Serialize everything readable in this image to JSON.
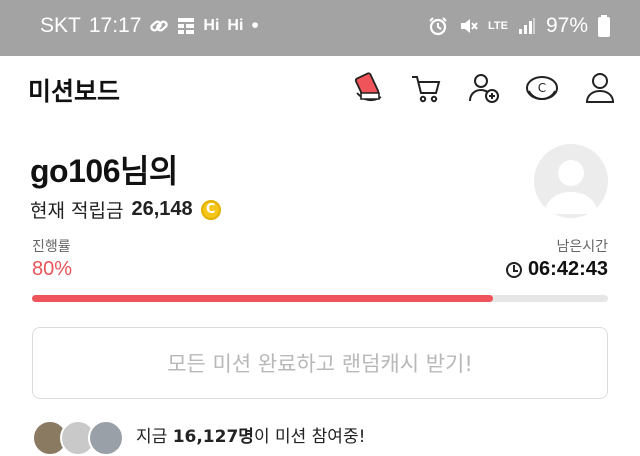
{
  "status_bar": {
    "carrier": "SKT",
    "time": "17:17",
    "hi1": "Hi",
    "hi2": "Hi",
    "dot": "•",
    "lte": "LTE",
    "battery": "97%"
  },
  "app_bar": {
    "title": "미션보드",
    "icons": [
      "mission-card-icon",
      "cart-icon",
      "add-friend-icon",
      "coin-c-icon",
      "profile-icon"
    ]
  },
  "profile": {
    "username": "go106님의",
    "points_label": "현재 적립금",
    "points_value": "26,148",
    "coin_symbol": "C"
  },
  "progress": {
    "label": "진행률",
    "percent_text": "80%",
    "fraction": 0.8,
    "time_label": "남은시간",
    "time_left": "06:42:43"
  },
  "cta": {
    "label": "모든 미션 완료하고 랜덤캐시 받기!"
  },
  "participants": {
    "prefix": "지금",
    "count": "16,127명",
    "suffix": "이 미션 참여중!"
  },
  "colors": {
    "accent": "#f0545b",
    "status_bar": "#a3a3a3",
    "coin": "#f5c518"
  }
}
